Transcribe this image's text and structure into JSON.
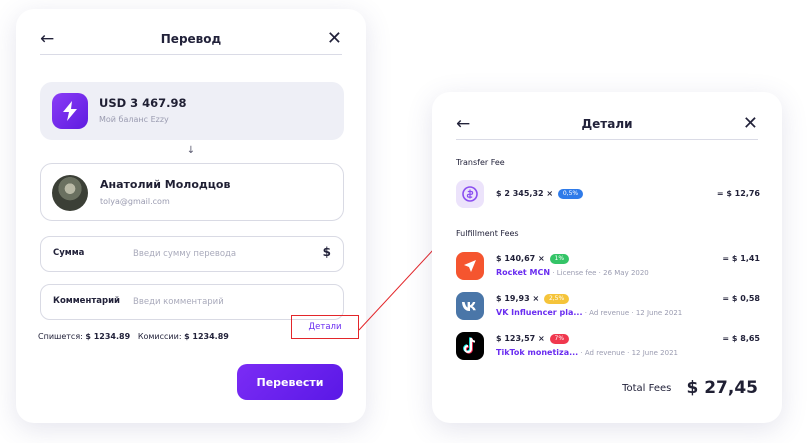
{
  "transfer": {
    "title": "Перевод",
    "back_icon": "arrow-left-icon",
    "close_icon": "close-icon",
    "balance": {
      "amount": "USD 3 467.98",
      "subtitle": "Мой баланс Ezzy",
      "icon": "lightning-icon",
      "accent": "#6a2df0"
    },
    "arrow": "↓",
    "recipient": {
      "name": "Анатолий Молодцов",
      "email": "tolya@gmail.com"
    },
    "amount_field": {
      "label": "Сумма",
      "placeholder": "Введи сумму перевода",
      "currency": "$"
    },
    "comment_field": {
      "label": "Комментарий",
      "placeholder": "Введи комментарий"
    },
    "summary": {
      "debit_label": "Спишется:",
      "debit_value": "$ 1234.89",
      "fee_label": "Комиссии:",
      "fee_value": "$ 1234.89"
    },
    "details_link": "Детали",
    "submit_label": "Перевести"
  },
  "details": {
    "title": "Детали",
    "transfer_fee_title": "Transfer Fee",
    "fulfillment_title": "Fulfillment Fees",
    "transfer_fee": {
      "calc": "$ 2 345,32 ×",
      "badge": "0,5%",
      "badge_bg": "#2f7be9",
      "result": "= $ 12,76"
    },
    "fees": [
      {
        "calc": "$ 140,67 ×",
        "badge": "1%",
        "badge_bg": "#34c467",
        "service": "Rocket MCN",
        "meta": " · License fee · 26 May 2020",
        "result": "= $ 1,41",
        "icon": "rocket-icon"
      },
      {
        "calc": "$ 19,93 ×",
        "badge": "2,5%",
        "badge_bg": "#f5c43a",
        "service": "VK Influencer pla...",
        "meta": " · Ad revenue · 12 June 2021",
        "result": "= $ 0,58",
        "icon": "vk-icon"
      },
      {
        "calc": "$ 123,57 ×",
        "badge": "7%",
        "badge_bg": "#f0384e",
        "service": "TikTok monetiza...",
        "meta": " · Ad revenue · 12 June 2021",
        "result": "= $ 8,65",
        "icon": "tiktok-icon"
      }
    ],
    "total_label": "Total Fees",
    "total_value": "$ 27,45"
  }
}
